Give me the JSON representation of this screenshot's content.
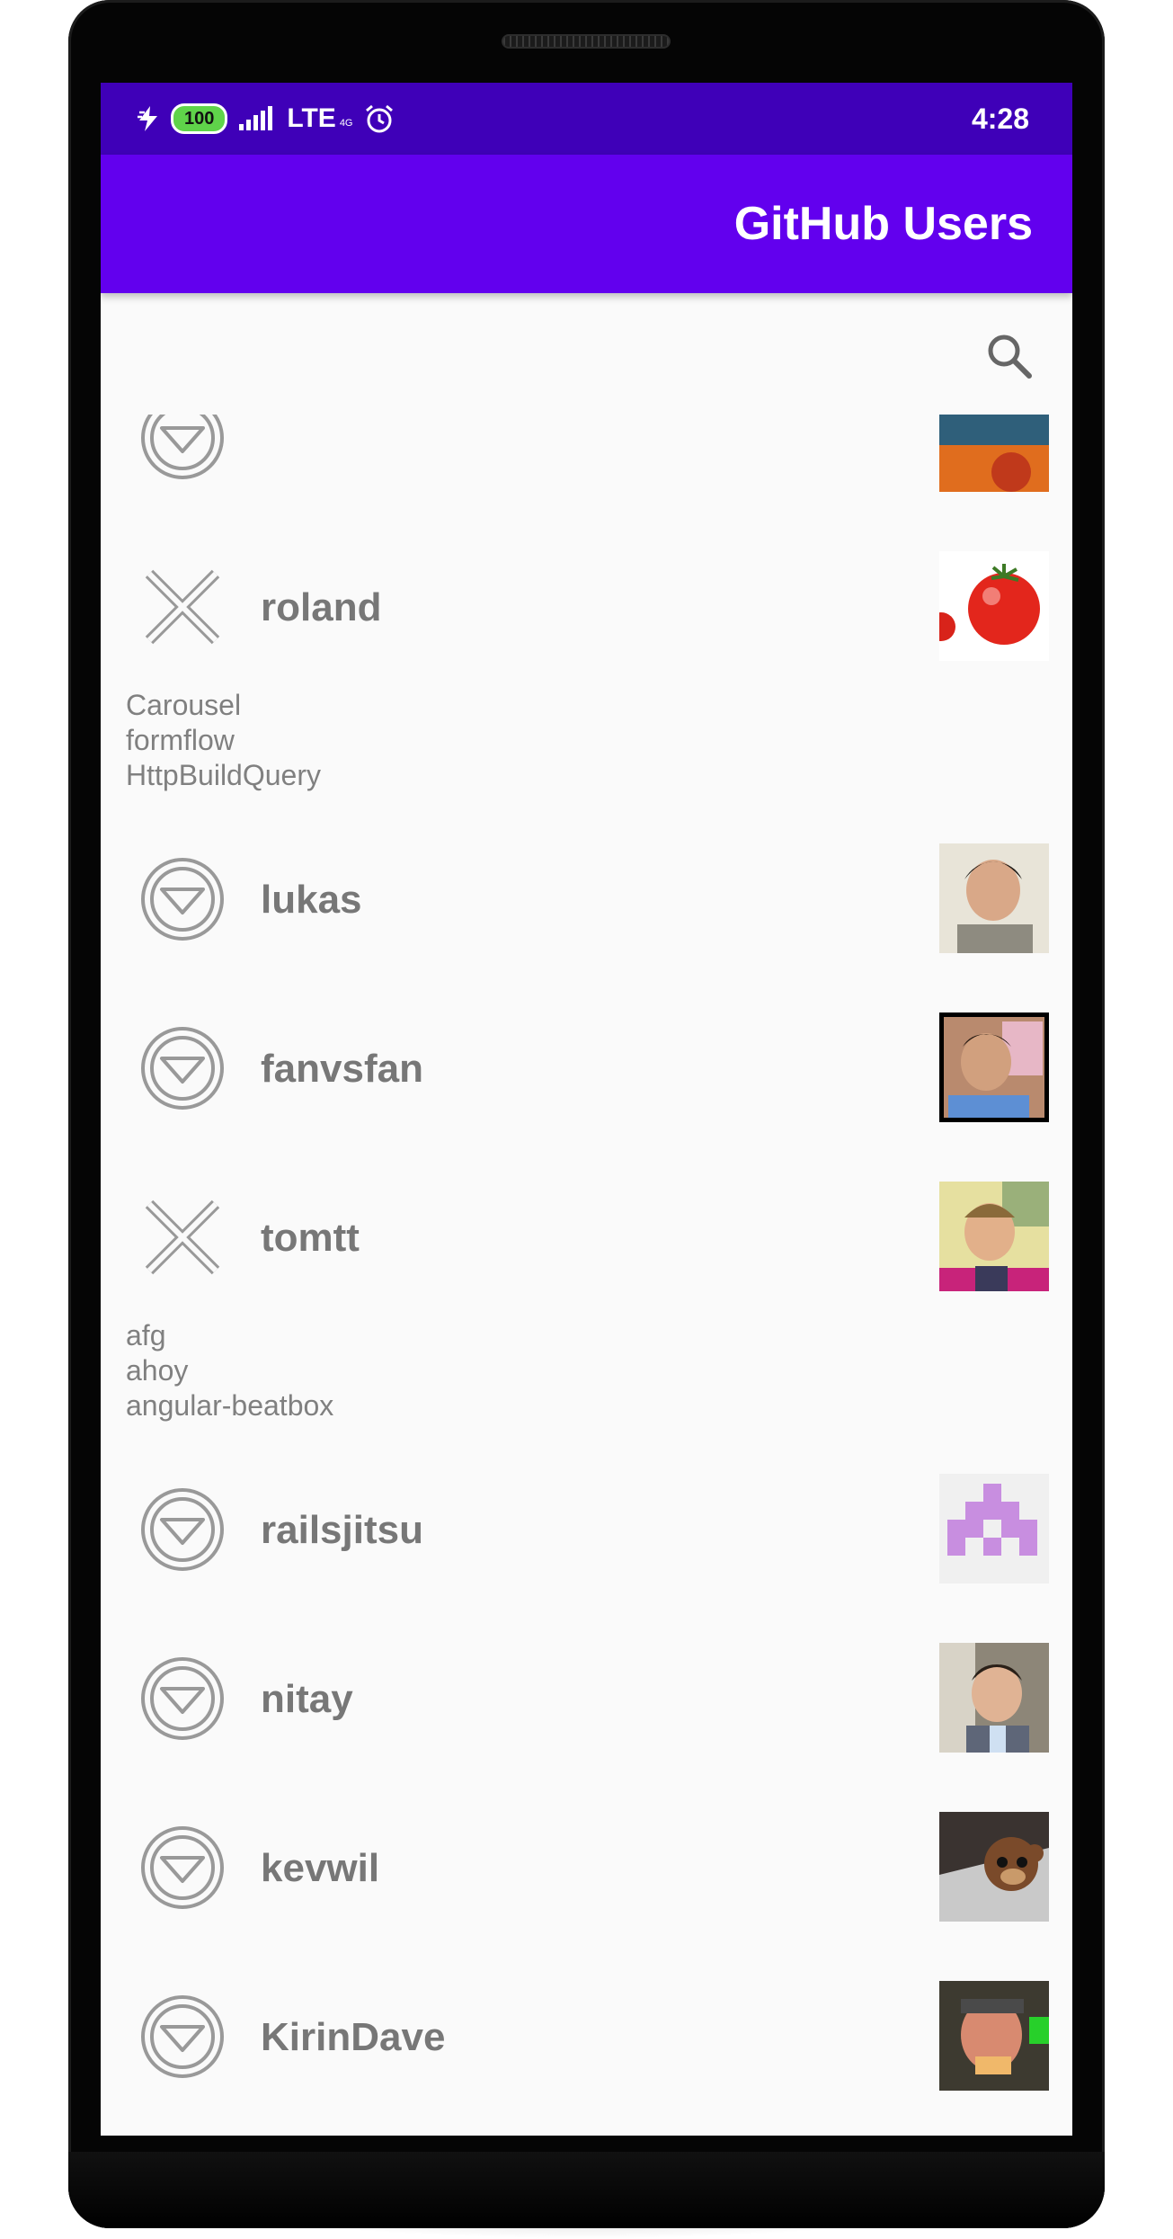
{
  "status_bar": {
    "battery": "100",
    "network": "LTE",
    "network_sub": "4G",
    "time": "4:28"
  },
  "app_bar": {
    "title": "GitHub Users"
  },
  "search": {
    "icon": "search-icon"
  },
  "users": [
    {
      "login": "",
      "state": "collapsed",
      "state_icon": "expand-icon",
      "avatar_icon": "avatar-orange",
      "repos": []
    },
    {
      "login": "roland",
      "state": "expanded",
      "state_icon": "close-icon",
      "avatar_icon": "avatar-tomato",
      "repos": [
        "Carousel",
        "formflow",
        "HttpBuildQuery"
      ]
    },
    {
      "login": "lukas",
      "state": "collapsed",
      "state_icon": "expand-icon",
      "avatar_icon": "avatar-photo",
      "repos": []
    },
    {
      "login": "fanvsfan",
      "state": "collapsed",
      "state_icon": "expand-icon",
      "avatar_icon": "avatar-photo",
      "repos": []
    },
    {
      "login": "tomtt",
      "state": "expanded",
      "state_icon": "close-icon",
      "avatar_icon": "avatar-photo",
      "repos": [
        "afg",
        "ahoy",
        "angular-beatbox"
      ]
    },
    {
      "login": "railsjitsu",
      "state": "collapsed",
      "state_icon": "expand-icon",
      "avatar_icon": "avatar-identicon",
      "repos": []
    },
    {
      "login": "nitay",
      "state": "collapsed",
      "state_icon": "expand-icon",
      "avatar_icon": "avatar-photo",
      "repos": []
    },
    {
      "login": "kevwil",
      "state": "collapsed",
      "state_icon": "expand-icon",
      "avatar_icon": "avatar-photo",
      "repos": []
    },
    {
      "login": "KirinDave",
      "state": "collapsed",
      "state_icon": "expand-icon",
      "avatar_icon": "avatar-photo",
      "repos": []
    },
    {
      "login": "",
      "state": "collapsed",
      "state_icon": "expand-icon",
      "avatar_icon": "avatar-photo",
      "repos": []
    }
  ],
  "colors": {
    "status_bar": "#3f00b8",
    "app_bar": "#6200ee",
    "list_background": "#fafafa",
    "username_text": "#777777",
    "icon_stroke": "#999999"
  }
}
